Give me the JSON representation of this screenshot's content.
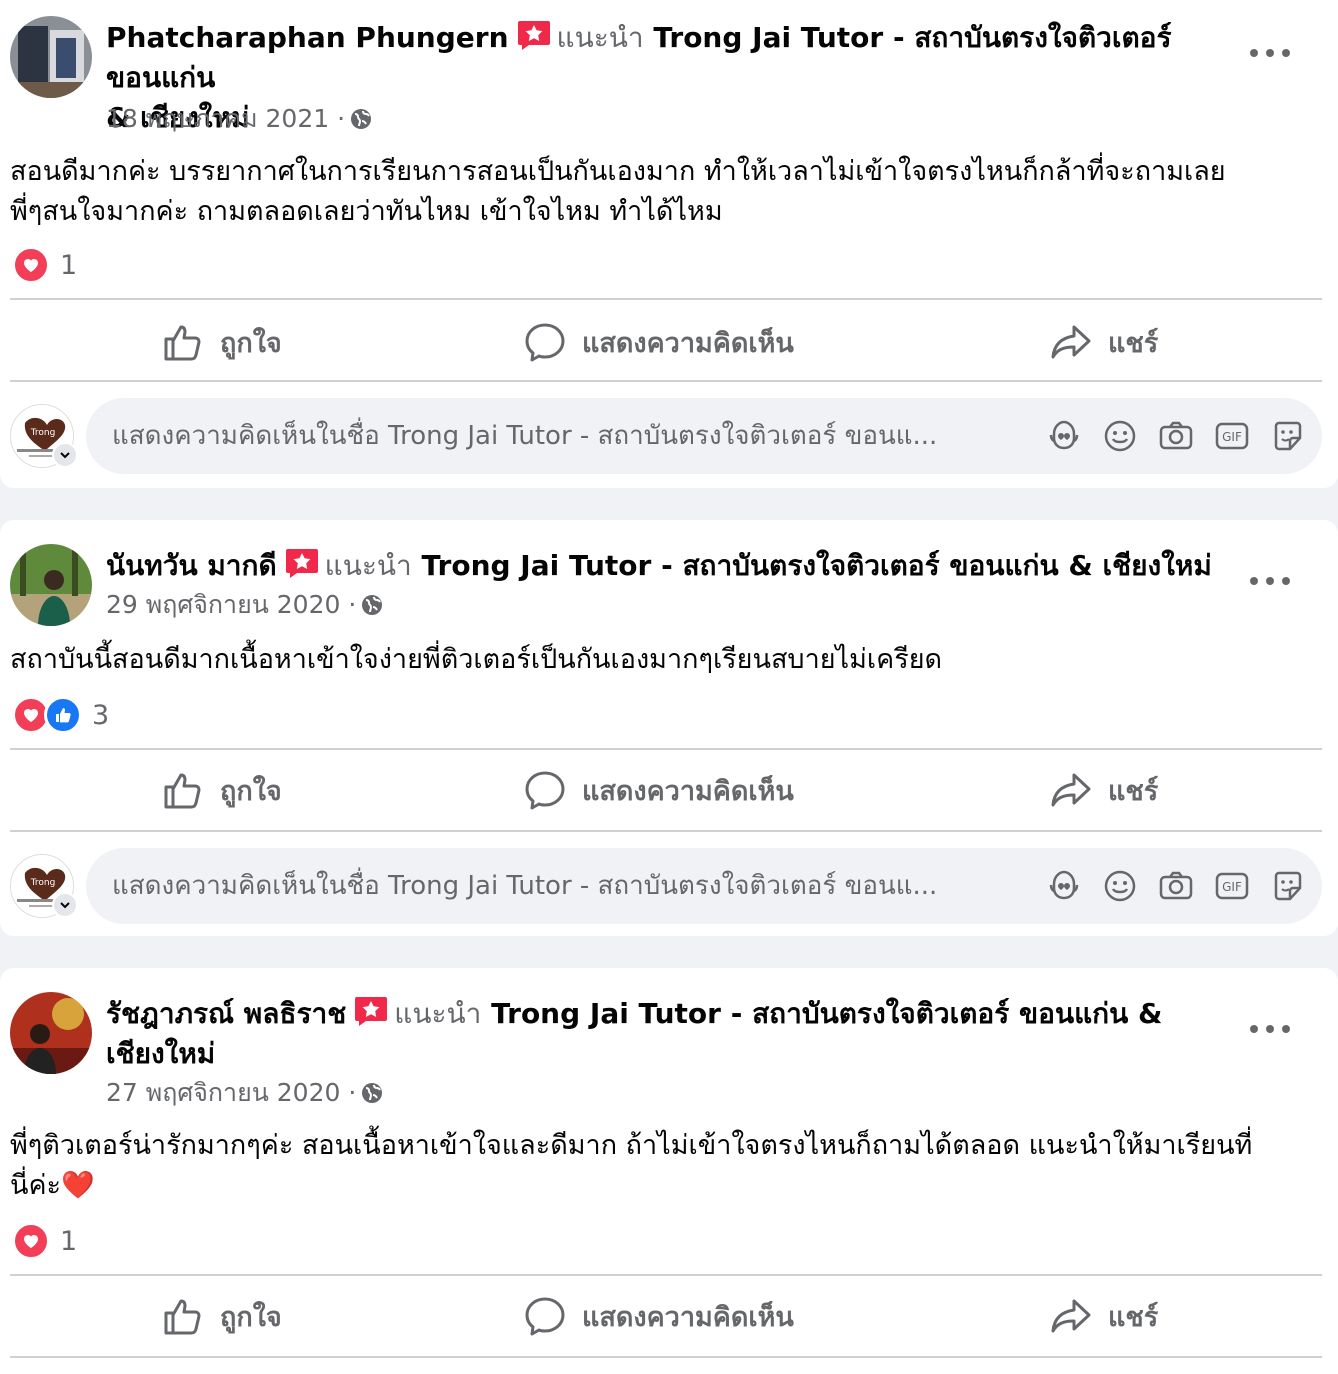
{
  "colors": {
    "background": "#f0f2f5",
    "card": "#ffffff",
    "secondary_text": "#65676b",
    "love": "#f33e58",
    "like": "#1877f2",
    "recommend": "#f02849"
  },
  "actions": {
    "like_label": "ถูกใจ",
    "comment_label": "แสดงความคิดเห็น",
    "share_label": "แชร์"
  },
  "comment_box": {
    "placeholder": "แสดงความคิดเห็นในชื่อ Trong Jai Tutor - สถาบันตรงใจติวเตอร์ ขอนแ..."
  },
  "posts": [
    {
      "author": "Phatcharaphan Phungern",
      "recommends_label": "แนะนำ",
      "page_line1": "Trong Jai Tutor - สถาบันตรงใจติวเตอร์ ขอนแก่น",
      "page_line2": "& เชียงใหม่",
      "date": "18 พฤษภาคม 2021",
      "separator": "·",
      "text_line1": "สอนดีมากค่ะ บรรยากาศในการเรียนการสอนเป็นกันเองมาก ทำให้เวลาไม่เข้าใจตรงไหนก็กล้าที่จะถามเลย",
      "text_line2": "พี่ๆสนใจมากค่ะ ถามตลอดเลยว่าทันไหม เข้าใจไหม ทำได้ไหม",
      "reactions": [
        "love"
      ],
      "reaction_count": "1"
    },
    {
      "author": "นันทวัน มากดี",
      "recommends_label": "แนะนำ",
      "page_line1": "Trong Jai Tutor - สถาบันตรงใจติวเตอร์ ขอนแก่น & เชียงใหม่",
      "date": "29 พฤศจิกายน 2020",
      "separator": "·",
      "text_line1": "สถาบันนี้สอนดีมากเนื้อหาเข้าใจง่ายพี่ติวเตอร์เป็นกันเองมากๆเรียนสบายไม่เครียด",
      "reactions": [
        "love",
        "like"
      ],
      "reaction_count": "3"
    },
    {
      "author": "รัชฎาภรณ์ พลธิราช",
      "recommends_label": "แนะนำ",
      "page_line1": "Trong Jai Tutor - สถาบันตรงใจติวเตอร์ ขอนแก่น &",
      "page_line2": "เชียงใหม่",
      "date": "27 พฤศจิกายน 2020",
      "separator": "·",
      "text_line1": "พี่ๆติวเตอร์น่ารักมากๆค่ะ สอนเนื้อหาเข้าใจและดีมาก ถ้าไม่เข้าใจตรงไหนก็ถามได้ตลอด แนะนำให้มาเรียนที่",
      "text_line2": "นี่ค่ะ❤️",
      "reactions": [
        "love"
      ],
      "reaction_count": "1"
    }
  ]
}
